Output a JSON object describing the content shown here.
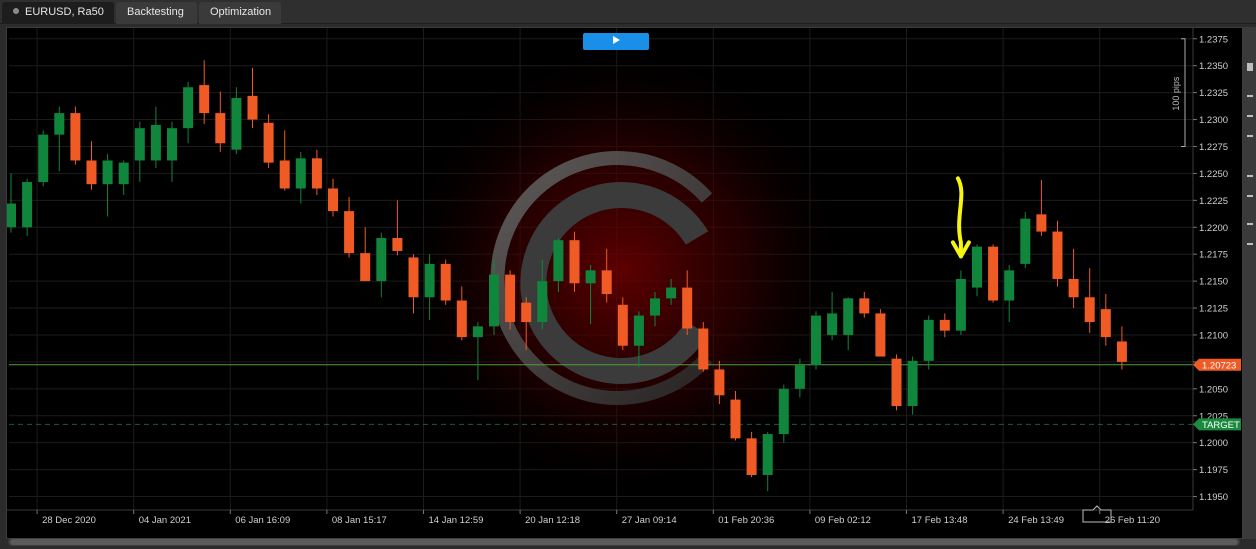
{
  "tabs": [
    {
      "label": "EURUSD, Ra50",
      "active": true
    },
    {
      "label": "Backtesting",
      "active": false
    },
    {
      "label": "Optimization",
      "active": false
    }
  ],
  "play_icon": "play-icon",
  "colors": {
    "background": "#000000",
    "bull": "#10853c",
    "bear": "#f05a25",
    "price_line": "#4f9e3b",
    "price_label_bg": "#f05a25",
    "target_line": "#15603a",
    "target_label_bg": "#1a8a3e",
    "annotation_arrow": "#f5f50f",
    "play_button": "#1a8fe8"
  },
  "chart_data": {
    "type": "candlestick",
    "symbol": "EURUSD",
    "ylim": [
      1.19375,
      1.2385
    ],
    "y_ticks": [
      "1.2375",
      "1.2350",
      "1.2325",
      "1.2300",
      "1.2275",
      "1.2250",
      "1.2225",
      "1.2200",
      "1.2175",
      "1.2150",
      "1.2125",
      "1.2100",
      "1.2075",
      "1.2050",
      "1.2025",
      "1.2000",
      "1.1975",
      "1.1950"
    ],
    "x_ticks": [
      {
        "index": 1,
        "label": "28 Dec 2020"
      },
      {
        "index": 7,
        "label": "04 Jan 2021"
      },
      {
        "index": 13,
        "label": "06 Jan 16:09"
      },
      {
        "index": 19,
        "label": "08 Jan 15:17"
      },
      {
        "index": 25,
        "label": "14 Jan 12:59"
      },
      {
        "index": 31,
        "label": "20 Jan 12:18"
      },
      {
        "index": 37,
        "label": "27 Jan 09:14"
      },
      {
        "index": 43,
        "label": "01 Feb 20:36"
      },
      {
        "index": 49,
        "label": "09 Feb 02:12"
      },
      {
        "index": 55,
        "label": "17 Feb 13:48"
      },
      {
        "index": 61,
        "label": "24 Feb 13:49"
      },
      {
        "index": 67,
        "label": "26 Feb 11:20"
      }
    ],
    "scale_label": "100 pips",
    "scale_range": [
      1.2275,
      1.2375
    ],
    "current_price": {
      "value": 1.20723,
      "label": "1.20723"
    },
    "target": {
      "value": 1.2017,
      "label": "TARGET"
    },
    "annotation_index": 59,
    "candles": [
      {
        "o": 1.22,
        "h": 1.225,
        "l": 1.2195,
        "c": 1.2222
      },
      {
        "o": 1.22,
        "h": 1.2245,
        "l": 1.2192,
        "c": 1.2242
      },
      {
        "o": 1.2242,
        "h": 1.229,
        "l": 1.2238,
        "c": 1.2286
      },
      {
        "o": 1.2286,
        "h": 1.2312,
        "l": 1.2252,
        "c": 1.2306
      },
      {
        "o": 1.2306,
        "h": 1.2312,
        "l": 1.2258,
        "c": 1.2262
      },
      {
        "o": 1.2262,
        "h": 1.228,
        "l": 1.2235,
        "c": 1.224
      },
      {
        "o": 1.224,
        "h": 1.2268,
        "l": 1.221,
        "c": 1.2262
      },
      {
        "o": 1.224,
        "h": 1.2262,
        "l": 1.223,
        "c": 1.226
      },
      {
        "o": 1.2262,
        "h": 1.2298,
        "l": 1.2242,
        "c": 1.2292
      },
      {
        "o": 1.2262,
        "h": 1.2312,
        "l": 1.2255,
        "c": 1.2295
      },
      {
        "o": 1.2262,
        "h": 1.2298,
        "l": 1.2242,
        "c": 1.2292
      },
      {
        "o": 1.2292,
        "h": 1.2335,
        "l": 1.2278,
        "c": 1.233
      },
      {
        "o": 1.2332,
        "h": 1.2355,
        "l": 1.2296,
        "c": 1.2306
      },
      {
        "o": 1.2306,
        "h": 1.2326,
        "l": 1.227,
        "c": 1.2278
      },
      {
        "o": 1.2272,
        "h": 1.233,
        "l": 1.2268,
        "c": 1.232
      },
      {
        "o": 1.2322,
        "h": 1.2348,
        "l": 1.2292,
        "c": 1.23
      },
      {
        "o": 1.2297,
        "h": 1.2305,
        "l": 1.2255,
        "c": 1.226
      },
      {
        "o": 1.2262,
        "h": 1.229,
        "l": 1.2234,
        "c": 1.2236
      },
      {
        "o": 1.2236,
        "h": 1.227,
        "l": 1.2222,
        "c": 1.2264
      },
      {
        "o": 1.2264,
        "h": 1.2272,
        "l": 1.223,
        "c": 1.2236
      },
      {
        "o": 1.2236,
        "h": 1.2245,
        "l": 1.221,
        "c": 1.2215
      },
      {
        "o": 1.2215,
        "h": 1.2228,
        "l": 1.2172,
        "c": 1.2176
      },
      {
        "o": 1.2176,
        "h": 1.22,
        "l": 1.215,
        "c": 1.215
      },
      {
        "o": 1.215,
        "h": 1.2195,
        "l": 1.2135,
        "c": 1.219
      },
      {
        "o": 1.219,
        "h": 1.2225,
        "l": 1.2174,
        "c": 1.2178
      },
      {
        "o": 1.2172,
        "h": 1.2175,
        "l": 1.212,
        "c": 1.2135
      },
      {
        "o": 1.2135,
        "h": 1.2175,
        "l": 1.2114,
        "c": 1.2166
      },
      {
        "o": 1.2166,
        "h": 1.217,
        "l": 1.2128,
        "c": 1.2132
      },
      {
        "o": 1.2132,
        "h": 1.2145,
        "l": 1.2095,
        "c": 1.2098
      },
      {
        "o": 1.2098,
        "h": 1.2112,
        "l": 1.2058,
        "c": 1.2108
      },
      {
        "o": 1.2108,
        "h": 1.217,
        "l": 1.21,
        "c": 1.2156
      },
      {
        "o": 1.2156,
        "h": 1.216,
        "l": 1.2105,
        "c": 1.2112
      },
      {
        "o": 1.213,
        "h": 1.2135,
        "l": 1.2086,
        "c": 1.2112
      },
      {
        "o": 1.2112,
        "h": 1.217,
        "l": 1.2105,
        "c": 1.215
      },
      {
        "o": 1.215,
        "h": 1.219,
        "l": 1.214,
        "c": 1.2188
      },
      {
        "o": 1.2188,
        "h": 1.2196,
        "l": 1.214,
        "c": 1.2148
      },
      {
        "o": 1.2148,
        "h": 1.2165,
        "l": 1.211,
        "c": 1.216
      },
      {
        "o": 1.216,
        "h": 1.218,
        "l": 1.213,
        "c": 1.2138
      },
      {
        "o": 1.2128,
        "h": 1.2135,
        "l": 1.2086,
        "c": 1.209
      },
      {
        "o": 1.209,
        "h": 1.2122,
        "l": 1.207,
        "c": 1.2118
      },
      {
        "o": 1.2118,
        "h": 1.214,
        "l": 1.2108,
        "c": 1.2134
      },
      {
        "o": 1.2134,
        "h": 1.2152,
        "l": 1.2128,
        "c": 1.2144
      },
      {
        "o": 1.2144,
        "h": 1.216,
        "l": 1.21,
        "c": 1.2106
      },
      {
        "o": 1.2106,
        "h": 1.2112,
        "l": 1.2066,
        "c": 1.2068
      },
      {
        "o": 1.2068,
        "h": 1.2076,
        "l": 1.2036,
        "c": 1.2044
      },
      {
        "o": 1.204,
        "h": 1.2048,
        "l": 1.2002,
        "c": 1.2004
      },
      {
        "o": 1.2004,
        "h": 1.201,
        "l": 1.1968,
        "c": 1.197
      },
      {
        "o": 1.197,
        "h": 1.201,
        "l": 1.1955,
        "c": 1.2008
      },
      {
        "o": 1.2008,
        "h": 1.2054,
        "l": 1.2,
        "c": 1.205
      },
      {
        "o": 1.205,
        "h": 1.2078,
        "l": 1.2042,
        "c": 1.2072
      },
      {
        "o": 1.2072,
        "h": 1.2122,
        "l": 1.2068,
        "c": 1.2118
      },
      {
        "o": 1.21,
        "h": 1.214,
        "l": 1.2095,
        "c": 1.212
      },
      {
        "o": 1.21,
        "h": 1.2135,
        "l": 1.2086,
        "c": 1.2134
      },
      {
        "o": 1.2134,
        "h": 1.214,
        "l": 1.2116,
        "c": 1.212
      },
      {
        "o": 1.212,
        "h": 1.2124,
        "l": 1.208,
        "c": 1.208
      },
      {
        "o": 1.2078,
        "h": 1.2082,
        "l": 1.203,
        "c": 1.2034
      },
      {
        "o": 1.2034,
        "h": 1.208,
        "l": 1.2026,
        "c": 1.2076
      },
      {
        "o": 1.2076,
        "h": 1.2118,
        "l": 1.2068,
        "c": 1.2114
      },
      {
        "o": 1.2114,
        "h": 1.212,
        "l": 1.2098,
        "c": 1.2104
      },
      {
        "o": 1.2104,
        "h": 1.216,
        "l": 1.21,
        "c": 1.2152
      },
      {
        "o": 1.2144,
        "h": 1.2184,
        "l": 1.2136,
        "c": 1.2182
      },
      {
        "o": 1.2182,
        "h": 1.2184,
        "l": 1.213,
        "c": 1.2132
      },
      {
        "o": 1.2132,
        "h": 1.2165,
        "l": 1.2112,
        "c": 1.216
      },
      {
        "o": 1.2166,
        "h": 1.2214,
        "l": 1.2162,
        "c": 1.2208
      },
      {
        "o": 1.2212,
        "h": 1.2244,
        "l": 1.2192,
        "c": 1.2196
      },
      {
        "o": 1.2196,
        "h": 1.2206,
        "l": 1.2145,
        "c": 1.2152
      },
      {
        "o": 1.2152,
        "h": 1.218,
        "l": 1.2125,
        "c": 1.2135
      },
      {
        "o": 1.2135,
        "h": 1.2162,
        "l": 1.2102,
        "c": 1.2112
      },
      {
        "o": 1.2124,
        "h": 1.2138,
        "l": 1.209,
        "c": 1.2098
      },
      {
        "o": 1.2094,
        "h": 1.2108,
        "l": 1.2068,
        "c": 1.2075
      }
    ]
  }
}
